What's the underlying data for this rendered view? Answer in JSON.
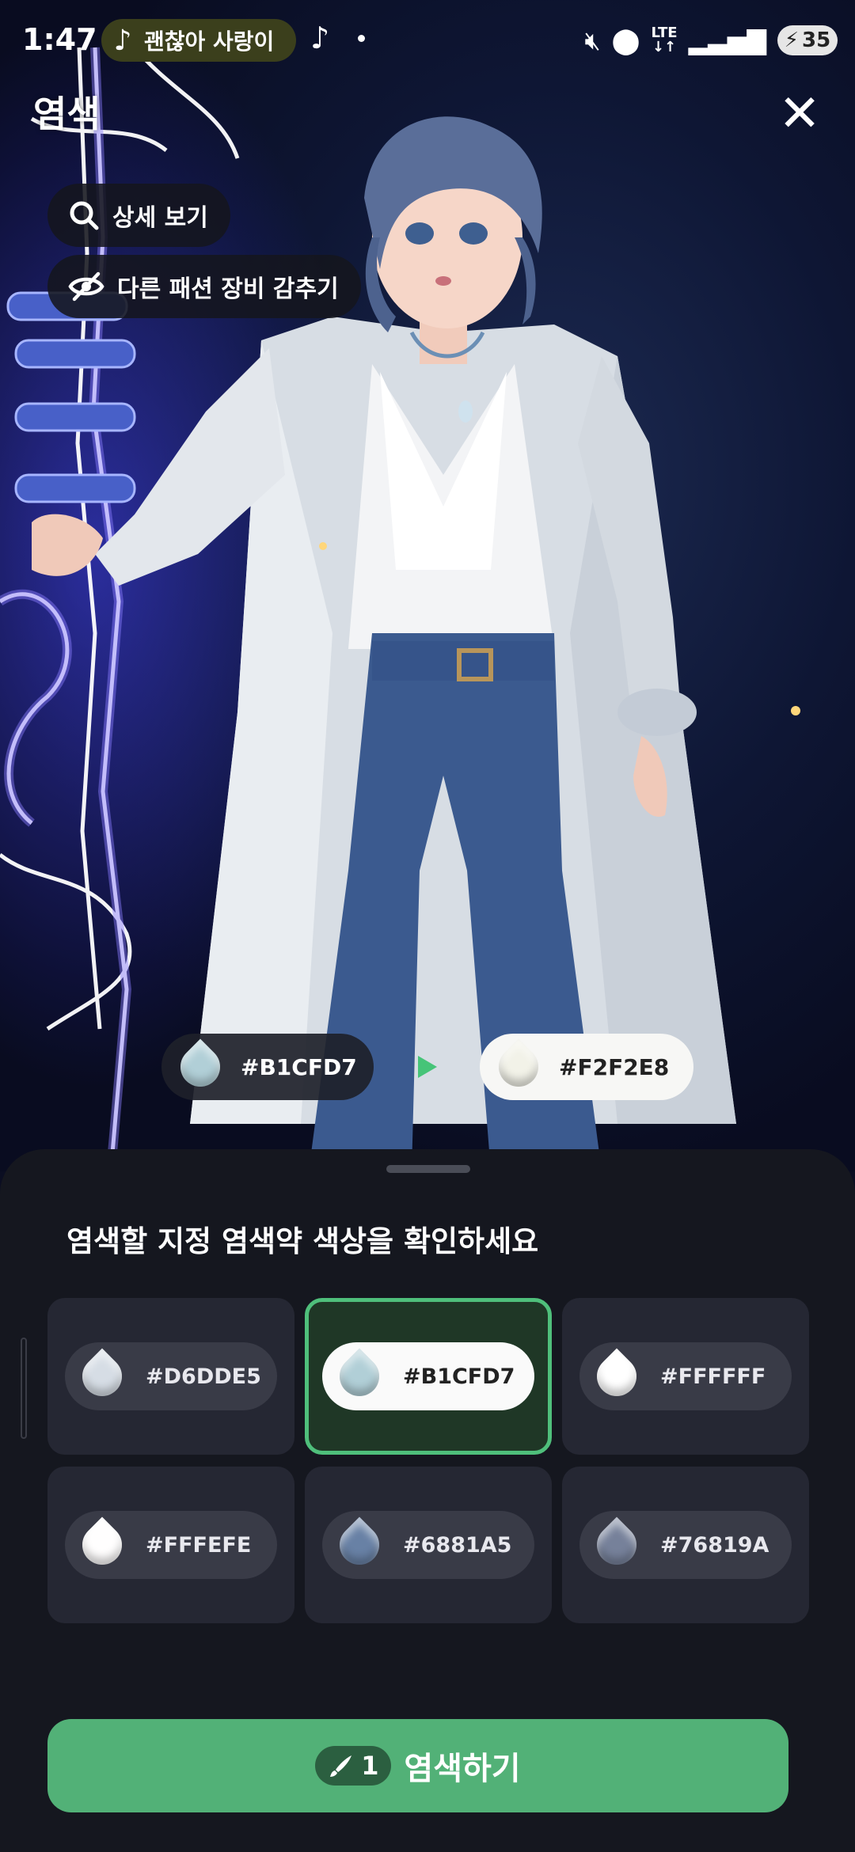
{
  "status": {
    "time": "1:47",
    "music_title": "괜찮아 사랑이",
    "network": "LTE",
    "battery": "35"
  },
  "header": {
    "title": "염색",
    "close_icon": "close-icon"
  },
  "chips": {
    "detail_label": "상세 보기",
    "hide_label": "다른 패션 장비 감추기"
  },
  "compare": {
    "from_hex": "#B1CFD7",
    "to_hex": "#F2F2E8",
    "from_color": "#B1CFD7",
    "to_color": "#F2F2E8"
  },
  "sheet": {
    "title": "염색할 지정 염색약 색상을 확인하세요",
    "swatches": [
      {
        "hex": "#D6DDE5",
        "color": "#D6DDE5",
        "selected": false
      },
      {
        "hex": "#B1CFD7",
        "color": "#B1CFD7",
        "selected": true
      },
      {
        "hex": "#FFFFFF",
        "color": "#FFFFFF",
        "selected": false
      },
      {
        "hex": "#FFFEFE",
        "color": "#FFFEFE",
        "selected": false
      },
      {
        "hex": "#6881A5",
        "color": "#6881A5",
        "selected": false
      },
      {
        "hex": "#76819A",
        "color": "#76819A",
        "selected": false
      }
    ]
  },
  "action": {
    "cost": "1",
    "label": "염색하기",
    "accent": "#52B177"
  }
}
